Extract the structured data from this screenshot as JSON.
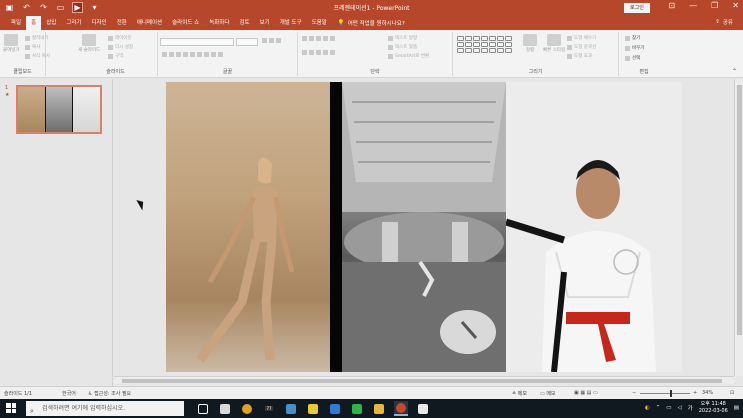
{
  "window": {
    "title": "프레젠테이션1 - PowerPoint",
    "login_label": "로그인",
    "minimize": "—",
    "restore": "❐",
    "close": "✕"
  },
  "tabs": [
    {
      "label": "파일",
      "active": false
    },
    {
      "label": "홈",
      "active": true
    },
    {
      "label": "삽입",
      "active": false
    },
    {
      "label": "그리기",
      "active": false
    },
    {
      "label": "디자인",
      "active": false
    },
    {
      "label": "전환",
      "active": false
    },
    {
      "label": "애니메이션",
      "active": false
    },
    {
      "label": "슬라이드 쇼",
      "active": false
    },
    {
      "label": "녹화하다",
      "active": false
    },
    {
      "label": "검토",
      "active": false
    },
    {
      "label": "보기",
      "active": false
    },
    {
      "label": "개발 도구",
      "active": false
    },
    {
      "label": "도움말",
      "active": false
    }
  ],
  "tellme": "어떤 작업을 원하시나요?",
  "share_label": "공유",
  "ribbon": {
    "clipboard": {
      "label": "클립보드",
      "paste": "붙여넣기",
      "cut": "잘라내기",
      "copy": "복사",
      "format_painter": "서식 복사"
    },
    "slides": {
      "label": "슬라이드",
      "new_slide": "새 슬라이드",
      "layout": "레이아웃",
      "reset": "다시 설정",
      "section": "구역"
    },
    "font": {
      "label": "글꼴"
    },
    "paragraph": {
      "label": "단락",
      "text_direction": "텍스트 방향",
      "align_text": "텍스트 맞춤",
      "smartart": "SmartArt로 변환"
    },
    "drawing": {
      "label": "그리기",
      "arrange": "정렬",
      "quick_styles": "빠른 스타일",
      "fill": "도형 채우기",
      "outline": "도형 윤곽선",
      "effects": "도형 효과"
    },
    "editing": {
      "label": "편집",
      "find": "찾기",
      "replace": "바꾸기",
      "select": "선택"
    }
  },
  "thumbnail": {
    "number": "1",
    "star": "★"
  },
  "status": {
    "slide_info": "슬라이드 1/1",
    "language": "한국어",
    "accessibility": "접근성: 조사 필요",
    "notes": "메모",
    "comments": "메모",
    "zoom": "34%"
  },
  "taskbar": {
    "search_placeholder": "검색하려면 여기에 입력하십시오.",
    "badge_count": "77",
    "ime": "가",
    "time": "오후 11:48",
    "date": "2022-03-06"
  }
}
